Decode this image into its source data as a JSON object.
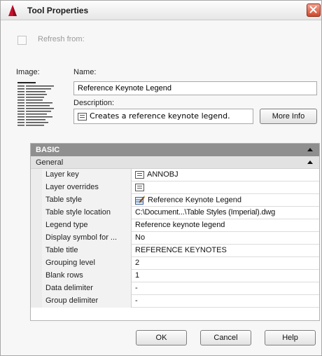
{
  "window": {
    "title": "Tool Properties"
  },
  "refresh": {
    "label": "Refresh from:",
    "checked": false
  },
  "image": {
    "label": "Image:"
  },
  "name": {
    "label": "Name:",
    "value": "Reference Keynote Legend"
  },
  "description": {
    "label": "Description:",
    "value": "Creates a reference keynote legend.",
    "more_info_label": "More Info"
  },
  "properties": {
    "category": "BASIC",
    "subcategory": "General",
    "rows": [
      {
        "name": "Layer key",
        "value": "ANNOBJ",
        "icon": "list-icon"
      },
      {
        "name": "Layer overrides",
        "value": "",
        "icon": "list-icon"
      },
      {
        "name": "Table style",
        "value": "Reference Keynote Legend",
        "icon": "table-style-icon"
      },
      {
        "name": "Table style location",
        "value": "C:\\Document...\\Table Styles (Imperial).dwg"
      },
      {
        "name": "Legend type",
        "value": "Reference keynote legend"
      },
      {
        "name": "Display symbol for ...",
        "value": "No"
      },
      {
        "name": "Table title",
        "value": "REFERENCE KEYNOTES"
      },
      {
        "name": "Grouping level",
        "value": "2"
      },
      {
        "name": "Blank rows",
        "value": "1"
      },
      {
        "name": "Data delimiter",
        "value": "-"
      },
      {
        "name": "Group delimiter",
        "value": "-"
      }
    ]
  },
  "buttons": {
    "ok": "OK",
    "cancel": "Cancel",
    "help": "Help"
  }
}
